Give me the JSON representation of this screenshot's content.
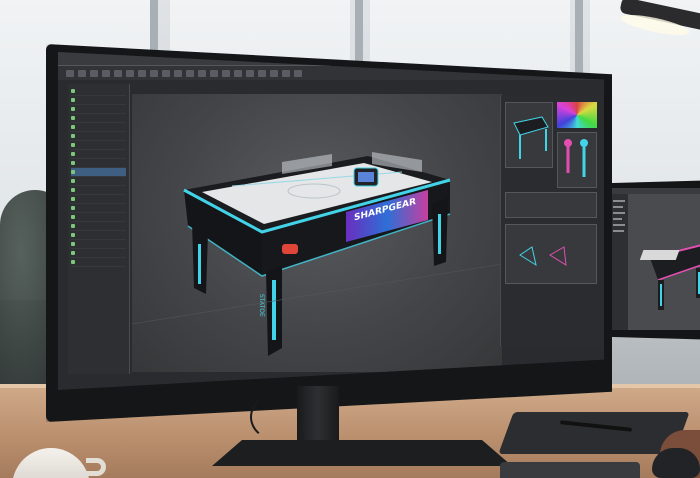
{
  "scene": {
    "subject": "curved-monitor-3d-modeling-workspace",
    "colors": {
      "accent_glow": "#43d3e8",
      "accent_pink": "#e24fb0",
      "ui_dark": "#2a2b2e",
      "desk_wood": "#b88d6c"
    }
  },
  "app": {
    "menu_items": [
      "",
      "",
      "",
      "",
      "",
      "",
      "",
      "",
      "",
      "",
      "",
      "",
      "",
      "",
      "",
      "",
      ""
    ],
    "outliner_rows": [
      "",
      "",
      "",
      "",
      "",
      "",
      "",
      "",
      "",
      "",
      "",
      "",
      "",
      "",
      "",
      "",
      "",
      "",
      "",
      "",
      "",
      "",
      "",
      "",
      ""
    ]
  },
  "artwork": {
    "table_banner_text": "SHARPGEAR",
    "leg_text": "STATOE"
  }
}
